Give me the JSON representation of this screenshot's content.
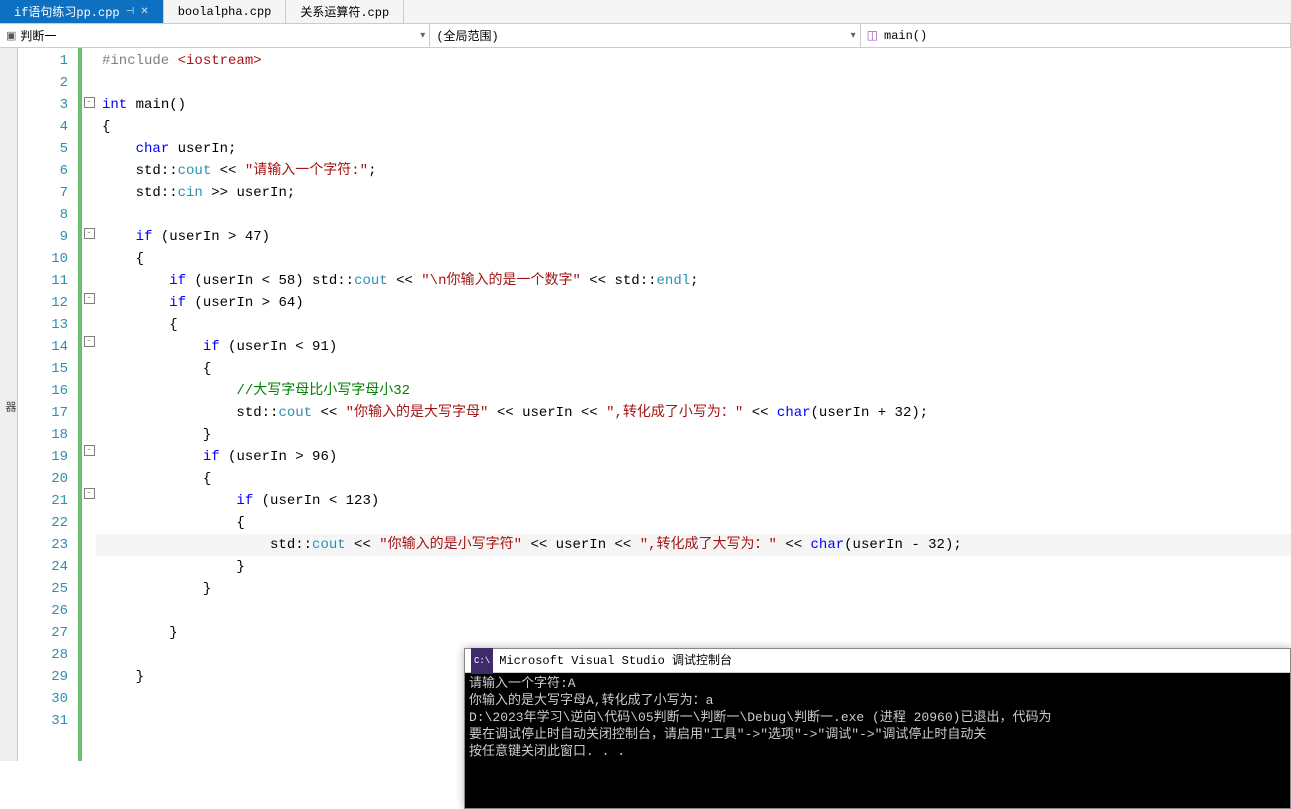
{
  "tabs": [
    {
      "label": "if语句练习pp.cpp",
      "active": true,
      "pinned": true,
      "closable": true
    },
    {
      "label": "boolalpha.cpp",
      "active": false
    },
    {
      "label": "关系运算符.cpp",
      "active": false
    }
  ],
  "nav": {
    "scope1": "判断一",
    "scope2": "(全局范围)",
    "func": "main()"
  },
  "left_strip": "器",
  "code_lines": [
    {
      "n": 1,
      "fold": "",
      "tokens": [
        [
          "pp",
          "#include "
        ],
        [
          "inc",
          "<iostream>"
        ]
      ]
    },
    {
      "n": 2,
      "fold": "",
      "tokens": []
    },
    {
      "n": 3,
      "fold": "box",
      "tokens": [
        [
          "kw",
          "int"
        ],
        [
          "punct",
          " main()"
        ]
      ]
    },
    {
      "n": 4,
      "fold": "",
      "tokens": [
        [
          "punct",
          "{"
        ]
      ]
    },
    {
      "n": 5,
      "fold": "",
      "tokens": [
        [
          "punct",
          "    "
        ],
        [
          "kw",
          "char"
        ],
        [
          "punct",
          " userIn;"
        ]
      ]
    },
    {
      "n": 6,
      "fold": "",
      "tokens": [
        [
          "punct",
          "    std::"
        ],
        [
          "cls",
          "cout"
        ],
        [
          "punct",
          " << "
        ],
        [
          "str",
          "\"请输入一个字符:\""
        ],
        [
          "punct",
          ";"
        ]
      ]
    },
    {
      "n": 7,
      "fold": "",
      "tokens": [
        [
          "punct",
          "    std::"
        ],
        [
          "cls",
          "cin"
        ],
        [
          "punct",
          " >> userIn;"
        ]
      ]
    },
    {
      "n": 8,
      "fold": "",
      "tokens": []
    },
    {
      "n": 9,
      "fold": "box",
      "tokens": [
        [
          "punct",
          "    "
        ],
        [
          "kw",
          "if"
        ],
        [
          "punct",
          " (userIn > 47)"
        ]
      ]
    },
    {
      "n": 10,
      "fold": "",
      "tokens": [
        [
          "punct",
          "    {"
        ]
      ]
    },
    {
      "n": 11,
      "fold": "",
      "tokens": [
        [
          "punct",
          "        "
        ],
        [
          "kw",
          "if"
        ],
        [
          "punct",
          " (userIn < 58) std::"
        ],
        [
          "cls",
          "cout"
        ],
        [
          "punct",
          " << "
        ],
        [
          "str",
          "\"\\n你输入的是一个数字\""
        ],
        [
          "punct",
          " << std::"
        ],
        [
          "cls",
          "endl"
        ],
        [
          "punct",
          ";"
        ]
      ]
    },
    {
      "n": 12,
      "fold": "box",
      "tokens": [
        [
          "punct",
          "        "
        ],
        [
          "kw",
          "if"
        ],
        [
          "punct",
          " (userIn > 64)"
        ]
      ]
    },
    {
      "n": 13,
      "fold": "",
      "tokens": [
        [
          "punct",
          "        {"
        ]
      ]
    },
    {
      "n": 14,
      "fold": "box",
      "tokens": [
        [
          "punct",
          "            "
        ],
        [
          "kw",
          "if"
        ],
        [
          "punct",
          " (userIn < 91)"
        ]
      ]
    },
    {
      "n": 15,
      "fold": "",
      "tokens": [
        [
          "punct",
          "            {"
        ]
      ]
    },
    {
      "n": 16,
      "fold": "",
      "tokens": [
        [
          "punct",
          "                "
        ],
        [
          "cmt",
          "//大写字母比小写字母小32"
        ]
      ]
    },
    {
      "n": 17,
      "fold": "",
      "tokens": [
        [
          "punct",
          "                std::"
        ],
        [
          "cls",
          "cout"
        ],
        [
          "punct",
          " << "
        ],
        [
          "str",
          "\"你输入的是大写字母\""
        ],
        [
          "punct",
          " << userIn << "
        ],
        [
          "str",
          "\",转化成了小写为：\""
        ],
        [
          "punct",
          " << "
        ],
        [
          "kw",
          "char"
        ],
        [
          "punct",
          "(userIn + 32);"
        ]
      ]
    },
    {
      "n": 18,
      "fold": "",
      "tokens": [
        [
          "punct",
          "            }"
        ]
      ]
    },
    {
      "n": 19,
      "fold": "box",
      "tokens": [
        [
          "punct",
          "            "
        ],
        [
          "kw",
          "if"
        ],
        [
          "punct",
          " (userIn > 96)"
        ]
      ]
    },
    {
      "n": 20,
      "fold": "",
      "tokens": [
        [
          "punct",
          "            {"
        ]
      ]
    },
    {
      "n": 21,
      "fold": "box",
      "tokens": [
        [
          "punct",
          "                "
        ],
        [
          "kw",
          "if"
        ],
        [
          "punct",
          " (userIn < 123)"
        ]
      ]
    },
    {
      "n": 22,
      "fold": "",
      "tokens": [
        [
          "punct",
          "                {"
        ]
      ]
    },
    {
      "n": 23,
      "fold": "",
      "hl": true,
      "tokens": [
        [
          "punct",
          "                    std::"
        ],
        [
          "cls",
          "cout"
        ],
        [
          "punct",
          " << "
        ],
        [
          "str",
          "\"你输入的是小写字符\""
        ],
        [
          "punct",
          " << userIn << "
        ],
        [
          "str",
          "\",转化成了大写为：\""
        ],
        [
          "punct",
          " << "
        ],
        [
          "kw",
          "char"
        ],
        [
          "punct",
          "(userIn - 32);"
        ]
      ]
    },
    {
      "n": 24,
      "fold": "",
      "tokens": [
        [
          "punct",
          "                }"
        ]
      ]
    },
    {
      "n": 25,
      "fold": "",
      "tokens": [
        [
          "punct",
          "            }"
        ]
      ]
    },
    {
      "n": 26,
      "fold": "",
      "tokens": []
    },
    {
      "n": 27,
      "fold": "",
      "tokens": [
        [
          "punct",
          "        }"
        ]
      ]
    },
    {
      "n": 28,
      "fold": "",
      "tokens": []
    },
    {
      "n": 29,
      "fold": "",
      "tokens": [
        [
          "punct",
          "    }"
        ]
      ]
    },
    {
      "n": 30,
      "fold": "",
      "tokens": []
    },
    {
      "n": 31,
      "fold": "",
      "tokens": []
    }
  ],
  "console": {
    "title": "Microsoft Visual Studio 调试控制台",
    "lines": [
      "请输入一个字符:A",
      "你输入的是大写字母A,转化成了小写为：a",
      "D:\\2023年学习\\逆向\\代码\\05判断一\\判断一\\Debug\\判断一.exe (进程 20960)已退出，代码为",
      "要在调试停止时自动关闭控制台，请启用\"工具\"->\"选项\"->\"调试\"->\"调试停止时自动关",
      "按任意键关闭此窗口. . ."
    ]
  }
}
